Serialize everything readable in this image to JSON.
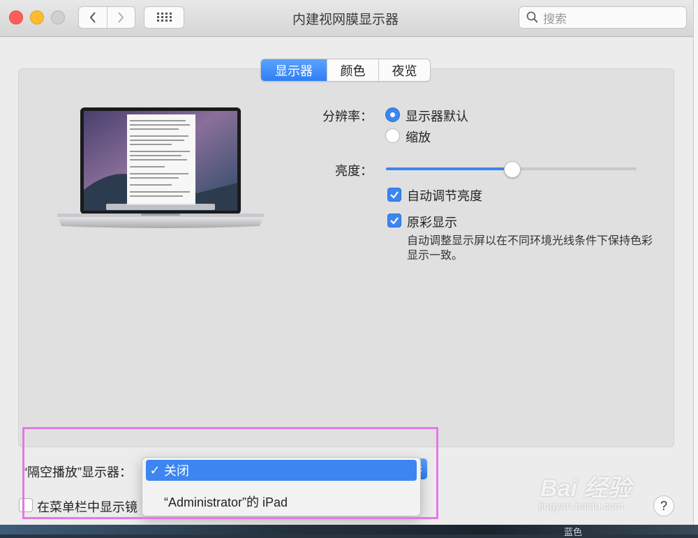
{
  "window": {
    "title": "内建视网膜显示器",
    "search_placeholder": "搜索"
  },
  "tabs": [
    {
      "label": "显示器",
      "selected": true
    },
    {
      "label": "颜色",
      "selected": false
    },
    {
      "label": "夜览",
      "selected": false
    }
  ],
  "resolution": {
    "label": "分辨率：",
    "options": [
      {
        "label": "显示器默认",
        "selected": true
      },
      {
        "label": "缩放",
        "selected": false
      }
    ]
  },
  "brightness": {
    "label": "亮度：",
    "level_fraction": 0.5,
    "auto_adjust": {
      "label": "自动调节亮度",
      "checked": true
    }
  },
  "true_tone": {
    "label": "原彩显示",
    "checked": true,
    "description": "自动调整显示屏以在不同环境光线条件下保持色彩显示一致。"
  },
  "airplay": {
    "label": "“隔空播放”显示器：",
    "menu_items": [
      {
        "label": "关闭",
        "selected": true
      },
      {
        "label": "“Administrator”的 iPad",
        "selected": false
      }
    ],
    "checkmark": "✓"
  },
  "menubar_option": {
    "label": "在菜单栏中显示镜",
    "checked": false
  },
  "help": {
    "label": "?"
  },
  "watermark": {
    "text": "Bai 经验",
    "url": "jingyan.baidu.com"
  },
  "background_fragment": "蓝色",
  "colors": {
    "accent": "#3d85f0",
    "annotation": "#e478e8"
  }
}
